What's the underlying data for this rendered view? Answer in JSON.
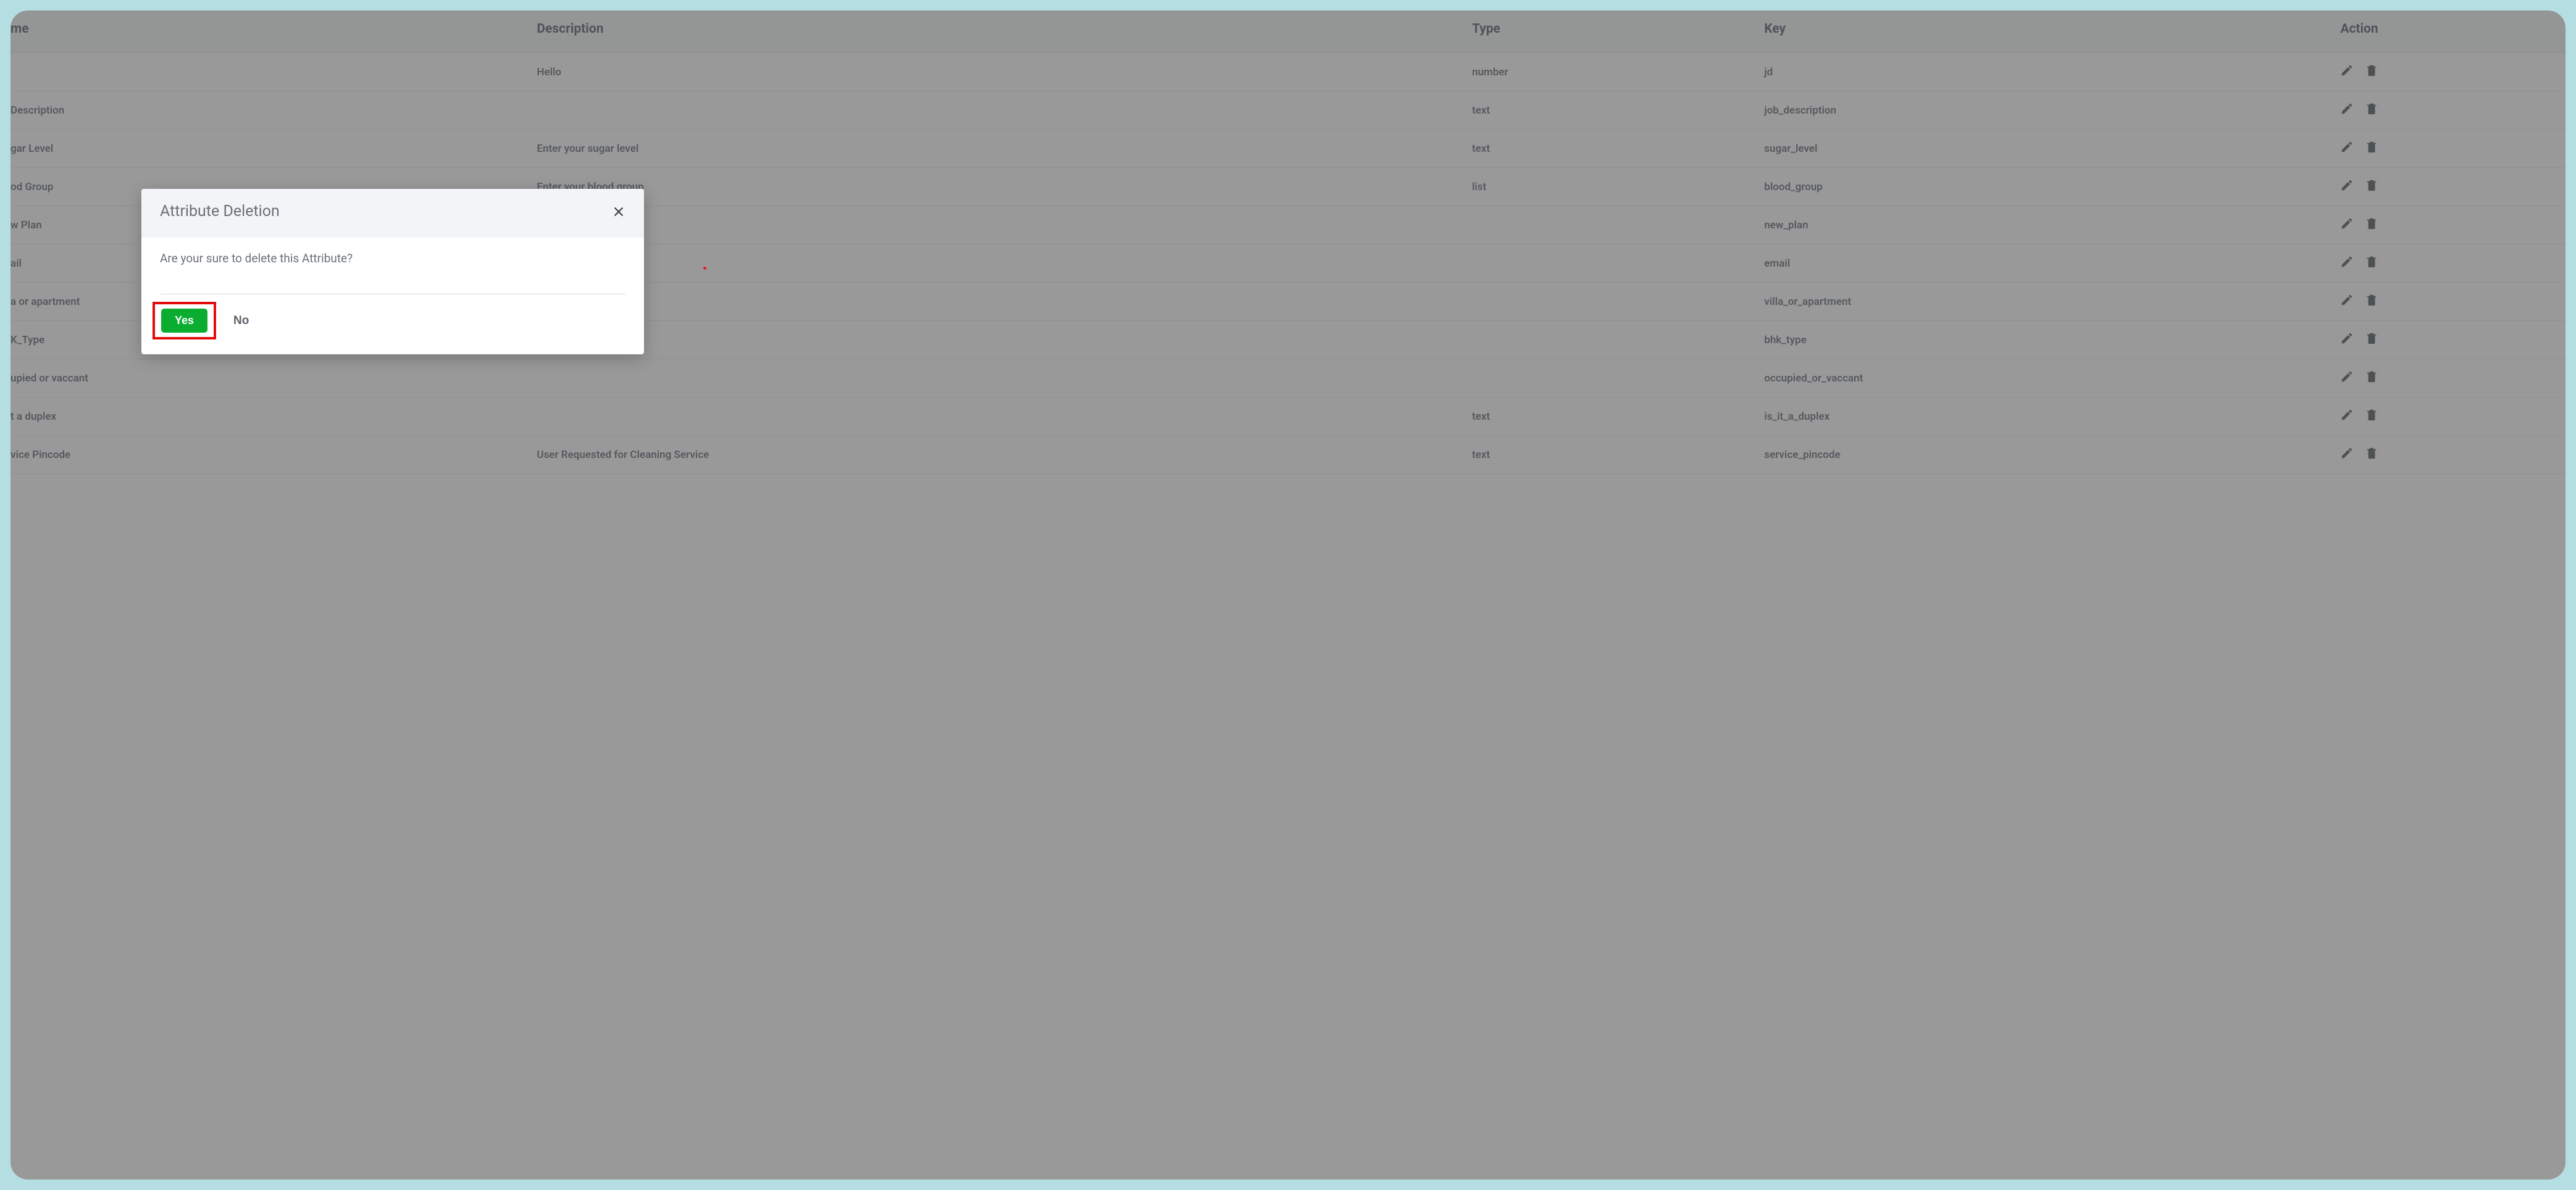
{
  "table": {
    "headers": {
      "name": "me",
      "description": "Description",
      "type": "Type",
      "key": "Key",
      "action": "Action"
    },
    "rows": [
      {
        "name": "",
        "description": "Hello",
        "type": "number",
        "key": "jd"
      },
      {
        "name": "Description",
        "description": "",
        "type": "text",
        "key": "job_description"
      },
      {
        "name": "gar Level",
        "description": "Enter your sugar level",
        "type": "text",
        "key": "sugar_level"
      },
      {
        "name": "od Group",
        "description": "Enter your blood group",
        "type": "list",
        "key": "blood_group"
      },
      {
        "name": "w Plan",
        "description": "",
        "type": "",
        "key": "new_plan"
      },
      {
        "name": "ail",
        "description": "",
        "type": "",
        "key": "email"
      },
      {
        "name": "a or apartment",
        "description": "",
        "type": "",
        "key": "villa_or_apartment"
      },
      {
        "name": "K_Type",
        "description": "",
        "type": "",
        "key": "bhk_type"
      },
      {
        "name": "upied or vaccant",
        "description": "",
        "type": "",
        "key": "occupied_or_vaccant"
      },
      {
        "name": "t a duplex",
        "description": "",
        "type": "text",
        "key": "is_it_a_duplex"
      },
      {
        "name": "vice Pincode",
        "description": "User Requested for Cleaning Service",
        "type": "text",
        "key": "service_pincode"
      }
    ]
  },
  "modal": {
    "title": "Attribute Deletion",
    "message": "Are your sure to delete this Attribute?",
    "yes": "Yes",
    "no": "No"
  }
}
